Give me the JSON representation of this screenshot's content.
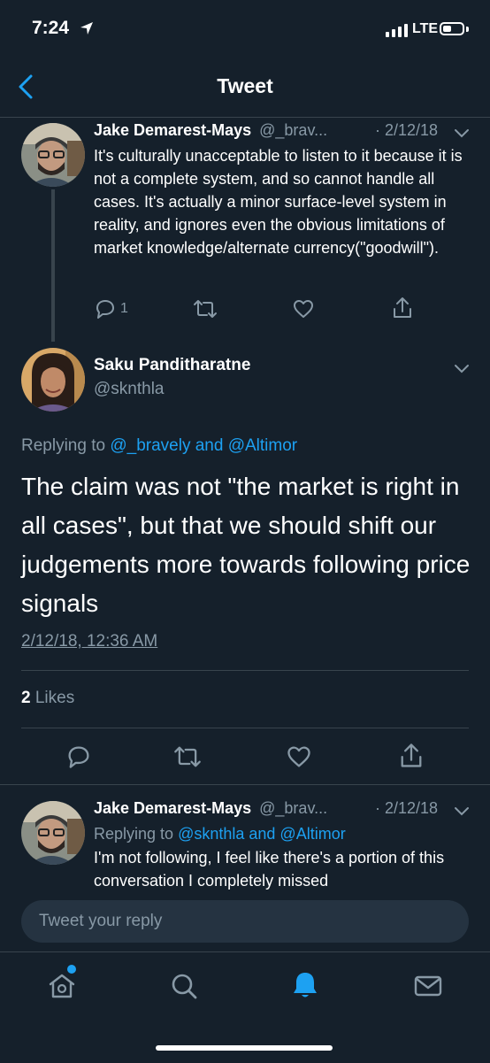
{
  "status_bar": {
    "time": "7:24",
    "network": "LTE"
  },
  "nav": {
    "title": "Tweet"
  },
  "tweets": [
    {
      "name": "Jake Demarest-Mays",
      "handle": "@_brav...",
      "sep_date": "· 2/12/18",
      "text": "It's culturally unacceptable to listen to it because it is not a complete system, and so cannot handle all cases. It's actually a minor surface-level system in reality, and ignores even the obvious limitations of market knowledge/alternate currency(\"goodwill\").",
      "reply_count": "1"
    },
    {
      "name": "Saku Panditharatne",
      "handle": "@sknthla",
      "replying_prefix": "Replying to",
      "replying_users": "@_bravely and @Altimor",
      "text": "The claim was not \"the market is right in all cases\", but that we should shift our judgements more towards following price signals",
      "timestamp": "2/12/18, 12:36 AM",
      "likes_count": "2",
      "likes_label": "Likes"
    },
    {
      "name": "Jake Demarest-Mays",
      "handle": "@_brav...",
      "sep_date": "· 2/12/18",
      "replying_prefix": "Replying to",
      "replying_users": "@sknthla and @Altimor",
      "text": "I'm not following, I feel like there's a portion of this conversation I completely missed"
    }
  ],
  "reply_box": {
    "placeholder": "Tweet your reply"
  },
  "tab_bar": {
    "items": [
      "home",
      "search",
      "notifications",
      "messages"
    ],
    "active": "notifications"
  },
  "colors": {
    "background": "#15202b",
    "accent": "#1da1f2",
    "muted": "#8899a6",
    "divider": "#38444d"
  }
}
